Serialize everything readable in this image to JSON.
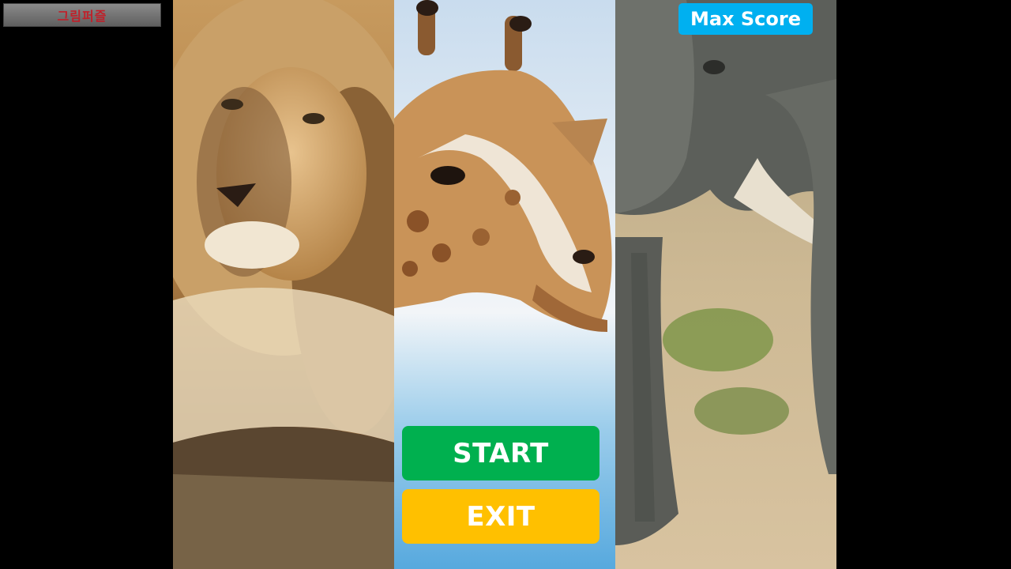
{
  "app": {
    "title": "그림퍼즐"
  },
  "menu": {
    "start_label": "START",
    "exit_label": "EXIT",
    "max_score_label": "Max Score"
  },
  "panels": [
    {
      "subject": "lion"
    },
    {
      "subject": "giraffe"
    },
    {
      "subject": "elephant"
    }
  ],
  "colors": {
    "start": "#00b04f",
    "exit": "#ffc000",
    "max_score": "#00b0f0",
    "title_text": "#c0202a"
  }
}
